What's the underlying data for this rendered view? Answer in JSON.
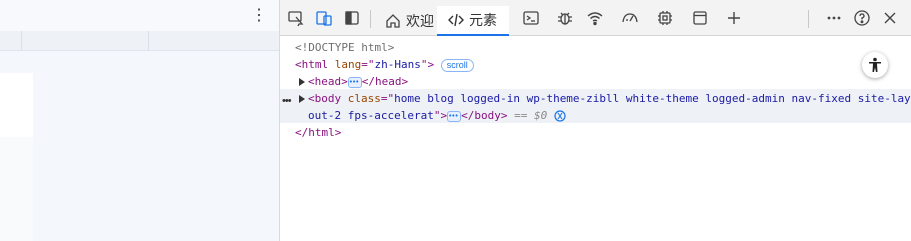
{
  "page": {
    "menu_icon": "kebab-icon"
  },
  "devtools": {
    "toolbar": {
      "inspect_icon": "inspect-cursor-icon",
      "device_icon": "device-emulation-icon",
      "dock_icon": "dock-sidebar-icon",
      "tabs": [
        {
          "label": "欢迎",
          "icon": "home-icon",
          "active": false
        },
        {
          "label": "元素",
          "icon": "code-icon",
          "active": true
        }
      ],
      "tool_icons": [
        "console-icon",
        "bug-icon",
        "wifi-icon",
        "performance-icon",
        "memory-chip-icon",
        "application-panel-icon",
        "add-tab-icon"
      ],
      "more_icon": "more-icon",
      "help_icon": "help-icon",
      "close_icon": "close-icon"
    },
    "dom": {
      "doctype": "<!DOCTYPE html>",
      "html_open": {
        "tag": "html",
        "attr": "lang",
        "value": "zh-Hans",
        "badge": "scroll"
      },
      "head": {
        "open": "<head>",
        "close": "</head>"
      },
      "body": {
        "tag": "body",
        "attr": "class",
        "value_line1": "home blog logged-in wp-theme-zibll white-theme logged-admin nav-fixed site-lay",
        "value_line2": "out-2 fps-accelerat",
        "close": "</body>",
        "eq_ref": "== $0"
      },
      "html_close": "</html>"
    },
    "accessibility_icon": "accessibility-icon",
    "accent_color": "#1a73e8"
  }
}
